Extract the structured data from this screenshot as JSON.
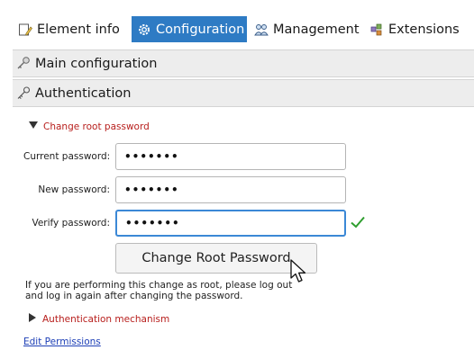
{
  "tabs": [
    {
      "label": "Element info",
      "icon": "document-edit-icon"
    },
    {
      "label": "Configuration",
      "icon": "gear-icon"
    },
    {
      "label": "Management",
      "icon": "people-icon"
    },
    {
      "label": "Extensions",
      "icon": "puzzle-icon"
    }
  ],
  "accordion": {
    "main": {
      "label": "Main configuration",
      "icon": "key-group-icon"
    },
    "auth": {
      "label": "Authentication",
      "icon": "key-icon"
    }
  },
  "change_root": {
    "toggle_label": "Change root password",
    "current_label": "Current password:",
    "current_value": "•••••••",
    "new_label": "New password:",
    "new_value": "•••••••",
    "verify_label": "Verify password:",
    "verify_value": "•••••••",
    "verify_status_icon": "checkmark-icon",
    "button_label": "Change Root Password",
    "note": "If you are performing this change as root, please log out and log in again after changing the password."
  },
  "auth_mechanism": {
    "toggle_label": "Authentication mechanism"
  },
  "edit_permissions_link": "Edit Permissions",
  "colors": {
    "active_tab": "#2e7bc4",
    "section_red": "#b8201e",
    "link_blue": "#1d3fb6",
    "focus_blue": "#3b88d6",
    "valid_green": "#2e9e2e"
  }
}
